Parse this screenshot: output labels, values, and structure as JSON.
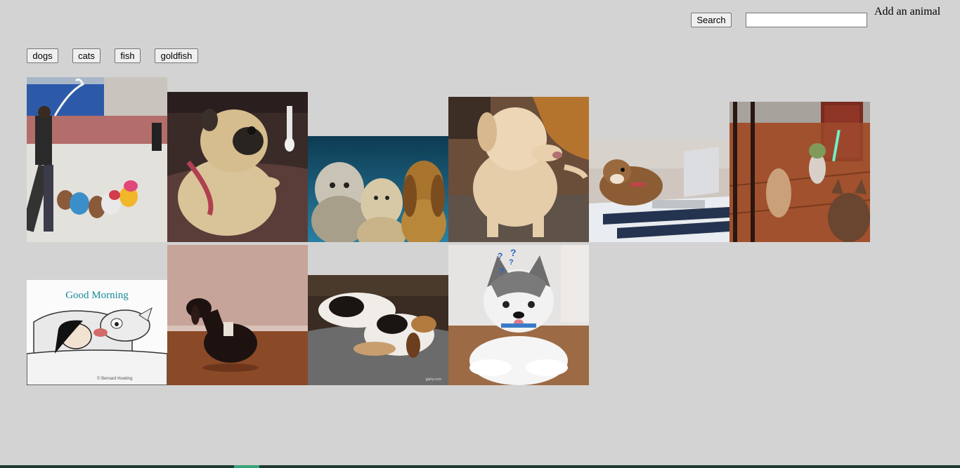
{
  "search": {
    "button_label": "Search",
    "input_value": "",
    "placeholder": ""
  },
  "add_animal": {
    "label": "Add an animal"
  },
  "filters": [
    "dogs",
    "cats",
    "fish",
    "goldfish"
  ],
  "gifs": [
    {
      "name": "gif-dogs-dancing-street",
      "icon": "dog-image"
    },
    {
      "name": "gif-pug-on-couch",
      "icon": "dog-image"
    },
    {
      "name": "gif-three-dogs-group",
      "icon": "dog-image"
    },
    {
      "name": "gif-labrador-yellow",
      "icon": "dog-image"
    },
    {
      "name": "gif-shiba-laptop",
      "icon": "dog-image"
    },
    {
      "name": "gif-corgi-yoda",
      "icon": "dog-image"
    },
    {
      "name": "gif-good-morning-cartoon",
      "caption": "Good Morning",
      "signature": "© Bernard Howling",
      "icon": "dog-image"
    },
    {
      "name": "gif-dachshund-floor",
      "icon": "dog-image"
    },
    {
      "name": "gif-basset-sleeping",
      "watermark": "giphy.com",
      "icon": "dog-image"
    },
    {
      "name": "gif-husky-question",
      "icon": "dog-image"
    }
  ],
  "colors": {
    "background": "#d3d3d3",
    "taskbar": "#1f3b30",
    "taskbar_accent": "#3aa37a"
  }
}
